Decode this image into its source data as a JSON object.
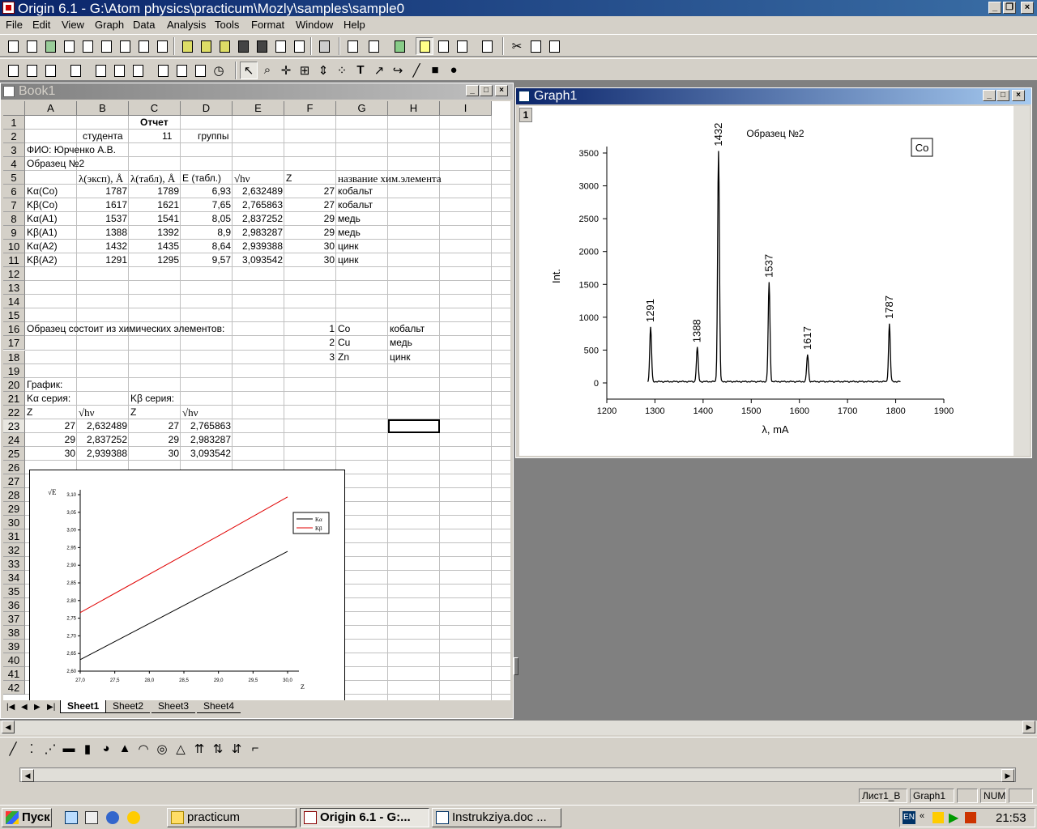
{
  "app": {
    "title": "Origin 6.1 - G:\\Atom physics\\practicum\\Mozly\\samples\\sample0",
    "menu": [
      "File",
      "Edit",
      "View",
      "Graph",
      "Data",
      "Analysis",
      "Tools",
      "Format",
      "Window",
      "Help"
    ]
  },
  "book": {
    "title": "Book1",
    "columns": [
      "A",
      "B",
      "C",
      "D",
      "E",
      "F",
      "G",
      "H",
      "I"
    ],
    "rows": [
      "1",
      "2",
      "3",
      "4",
      "5",
      "6",
      "7",
      "8",
      "9",
      "10",
      "11",
      "12",
      "13",
      "14",
      "15",
      "16",
      "17",
      "18",
      "19",
      "20",
      "21",
      "22",
      "23",
      "24",
      "25",
      "26",
      "27",
      "28",
      "29",
      "30",
      "31",
      "32",
      "33",
      "34",
      "35",
      "36",
      "37",
      "38",
      "39",
      "40",
      "41",
      "42"
    ],
    "header_cells": {
      "r1_title": "Отчет",
      "r2_a": "студента",
      "r2_num": "11",
      "r2_b": "группы",
      "r3": "ФИО: Юрченко А.В.",
      "r4": "Образец №2",
      "r5_b": "λ(эксп), Å",
      "r5_c": "λ(табл), Å",
      "r5_d": "E (табл.)",
      "r5_e": "√hν",
      "r5_f": "Z",
      "r5_g": "название хим.элемента"
    },
    "table": [
      {
        "label": "Kα(Co)",
        "exp": "1787",
        "tab": "1789",
        "e": "6,93",
        "sq": "2,632489",
        "z": "27",
        "name": "кобальт"
      },
      {
        "label": "Kβ(Co)",
        "exp": "1617",
        "tab": "1621",
        "e": "7,65",
        "sq": "2,765863",
        "z": "27",
        "name": "кобальт"
      },
      {
        "label": "Kα(A1)",
        "exp": "1537",
        "tab": "1541",
        "e": "8,05",
        "sq": "2,837252",
        "z": "29",
        "name": "медь"
      },
      {
        "label": "Kβ(A1)",
        "exp": "1388",
        "tab": "1392",
        "e": "8,9",
        "sq": "2,983287",
        "z": "29",
        "name": "медь"
      },
      {
        "label": "Kα(A2)",
        "exp": "1432",
        "tab": "1435",
        "e": "8,64",
        "sq": "2,939388",
        "z": "30",
        "name": "цинк"
      },
      {
        "label": "Kβ(A2)",
        "exp": "1291",
        "tab": "1295",
        "e": "9,57",
        "sq": "3,093542",
        "z": "30",
        "name": "цинк"
      }
    ],
    "composition_label": "Образец состоит из химических элементов:",
    "composition": [
      {
        "n": "1",
        "sym": "Co",
        "name": "кобальт"
      },
      {
        "n": "2",
        "sym": "Cu",
        "name": "медь"
      },
      {
        "n": "3",
        "sym": "Zn",
        "name": "цинк"
      }
    ],
    "graph_label": "График:",
    "ka_label": "Kα серия:",
    "kb_label": "Kβ серия:",
    "z_label": "Z",
    "sq_label": "√hν",
    "series_table": [
      {
        "za": "27",
        "a": "2,632489",
        "zb": "27",
        "b": "2,765863"
      },
      {
        "za": "29",
        "a": "2,837252",
        "zb": "29",
        "b": "2,983287"
      },
      {
        "za": "30",
        "a": "2,939388",
        "zb": "30",
        "b": "3,093542"
      }
    ],
    "sheets": [
      "Sheet1",
      "Sheet2",
      "Sheet3",
      "Sheet4"
    ]
  },
  "graph_window": {
    "title": "Graph1",
    "layer": "1"
  },
  "chart_data": [
    {
      "type": "line",
      "title": "Образец №2",
      "xlabel": "λ, mA",
      "ylabel": "Int.",
      "xlim": [
        1200,
        1900
      ],
      "ylim": [
        0,
        3500
      ],
      "xticks": [
        "1200",
        "1300",
        "1400",
        "1500",
        "1600",
        "1700",
        "1800",
        "1900"
      ],
      "yticks": [
        "0",
        "500",
        "1000",
        "1500",
        "2000",
        "2500",
        "3000",
        "3500"
      ],
      "legend_text": "Co",
      "legend_position": "top-right",
      "peaks": [
        {
          "x": 1291,
          "y": 850,
          "label": "1291"
        },
        {
          "x": 1388,
          "y": 540,
          "label": "1388"
        },
        {
          "x": 1432,
          "y": 3530,
          "label": "1432"
        },
        {
          "x": 1537,
          "y": 1530,
          "label": "1537"
        },
        {
          "x": 1617,
          "y": 430,
          "label": "1617"
        },
        {
          "x": 1787,
          "y": 900,
          "label": "1787"
        }
      ],
      "baseline": 20,
      "x_range_data": [
        1285,
        1810
      ]
    },
    {
      "type": "line",
      "ylabel": "√E",
      "xlabel": "Z",
      "xlim": [
        27,
        30
      ],
      "ylim": [
        2.6,
        3.1
      ],
      "xticks": [
        "27,0",
        "27,5",
        "28,0",
        "28,5",
        "29,0",
        "29,5",
        "30,0"
      ],
      "yticks": [
        "2,60",
        "2,65",
        "2,70",
        "2,75",
        "2,80",
        "2,85",
        "2,90",
        "2,95",
        "3,00",
        "3,05",
        "3,10"
      ],
      "legend_position": "top-right",
      "series": [
        {
          "name": "Kα",
          "color": "#000000",
          "x": [
            27,
            29,
            30
          ],
          "values": [
            2.632489,
            2.837252,
            2.939388
          ]
        },
        {
          "name": "Kβ",
          "color": "#e00000",
          "x": [
            27,
            29,
            30
          ],
          "values": [
            2.765863,
            2.983287,
            3.093542
          ]
        }
      ]
    }
  ],
  "status": {
    "sheet": "Лист1_B",
    "graph": "Graph1",
    "num": "NUM"
  },
  "taskbar": {
    "start": "Пуск",
    "tasks": [
      "practicum",
      "Origin 6.1 - G:...",
      "Instrukziya.doc ..."
    ],
    "lang": "EN",
    "clock": "21:53"
  }
}
